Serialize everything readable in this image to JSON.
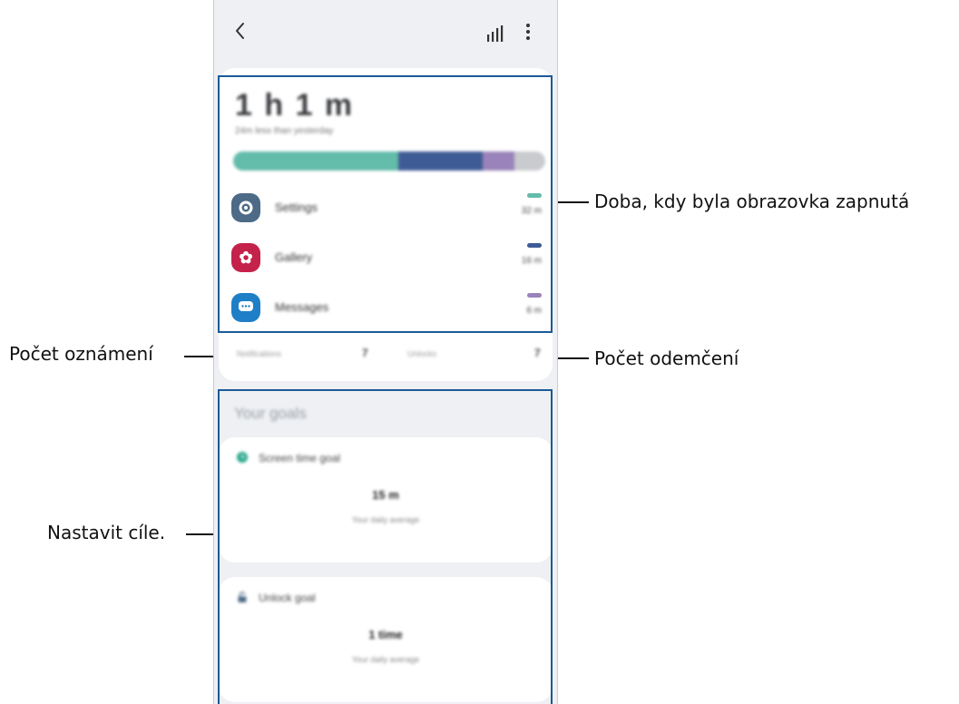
{
  "callouts": {
    "screen_on_time": "Doba, kdy byla obrazovka zapnutá",
    "notifications_count": "Počet oznámení",
    "unlocks_count": "Počet odemčení",
    "set_goals": "Nastavit cíle."
  },
  "phone": {
    "header": {
      "back_icon": "chevron-left-icon",
      "chart_icon": "bar-chart-icon",
      "more_icon": "more-vert-icon"
    },
    "summary": {
      "total_time": "1 h 1 m",
      "comparison_text": "24m less than yesterday",
      "usage_bar": [
        {
          "app": "Settings",
          "fraction": 0.53,
          "color": "#63bba9"
        },
        {
          "app": "Gallery",
          "fraction": 0.27,
          "color": "#3f5b96"
        },
        {
          "app": "Messages",
          "fraction": 0.1,
          "color": "#9a83ba"
        },
        {
          "app": "Other",
          "fraction": 0.1,
          "color": "#c9cbce"
        }
      ],
      "apps": [
        {
          "name": "Settings",
          "time": "32 m",
          "icon": "gear-icon",
          "icon_color": "#4d6a86",
          "mark_color": "#63bba9"
        },
        {
          "name": "Gallery",
          "time": "16 m",
          "icon": "flower-icon",
          "icon_color": "#c4224a",
          "mark_color": "#3f5b96"
        },
        {
          "name": "Messages",
          "time": "6 m",
          "icon": "chat-bubble-icon",
          "icon_color": "#1f7fc6",
          "mark_color": "#9a83ba"
        }
      ],
      "notifications_label": "Notifications",
      "notifications_value": "7",
      "unlocks_label": "Unlocks",
      "unlocks_value": "7"
    },
    "goals": {
      "section_title": "Your goals",
      "screen_time_goal": {
        "title": "Screen time goal",
        "icon": "clock-icon",
        "value": "15 m",
        "subtitle": "Your daily average"
      },
      "unlock_goal": {
        "title": "Unlock goal",
        "icon": "unlock-icon",
        "value": "1 time",
        "subtitle": "Your daily average"
      }
    },
    "highlight_color": "#1c5a96"
  }
}
